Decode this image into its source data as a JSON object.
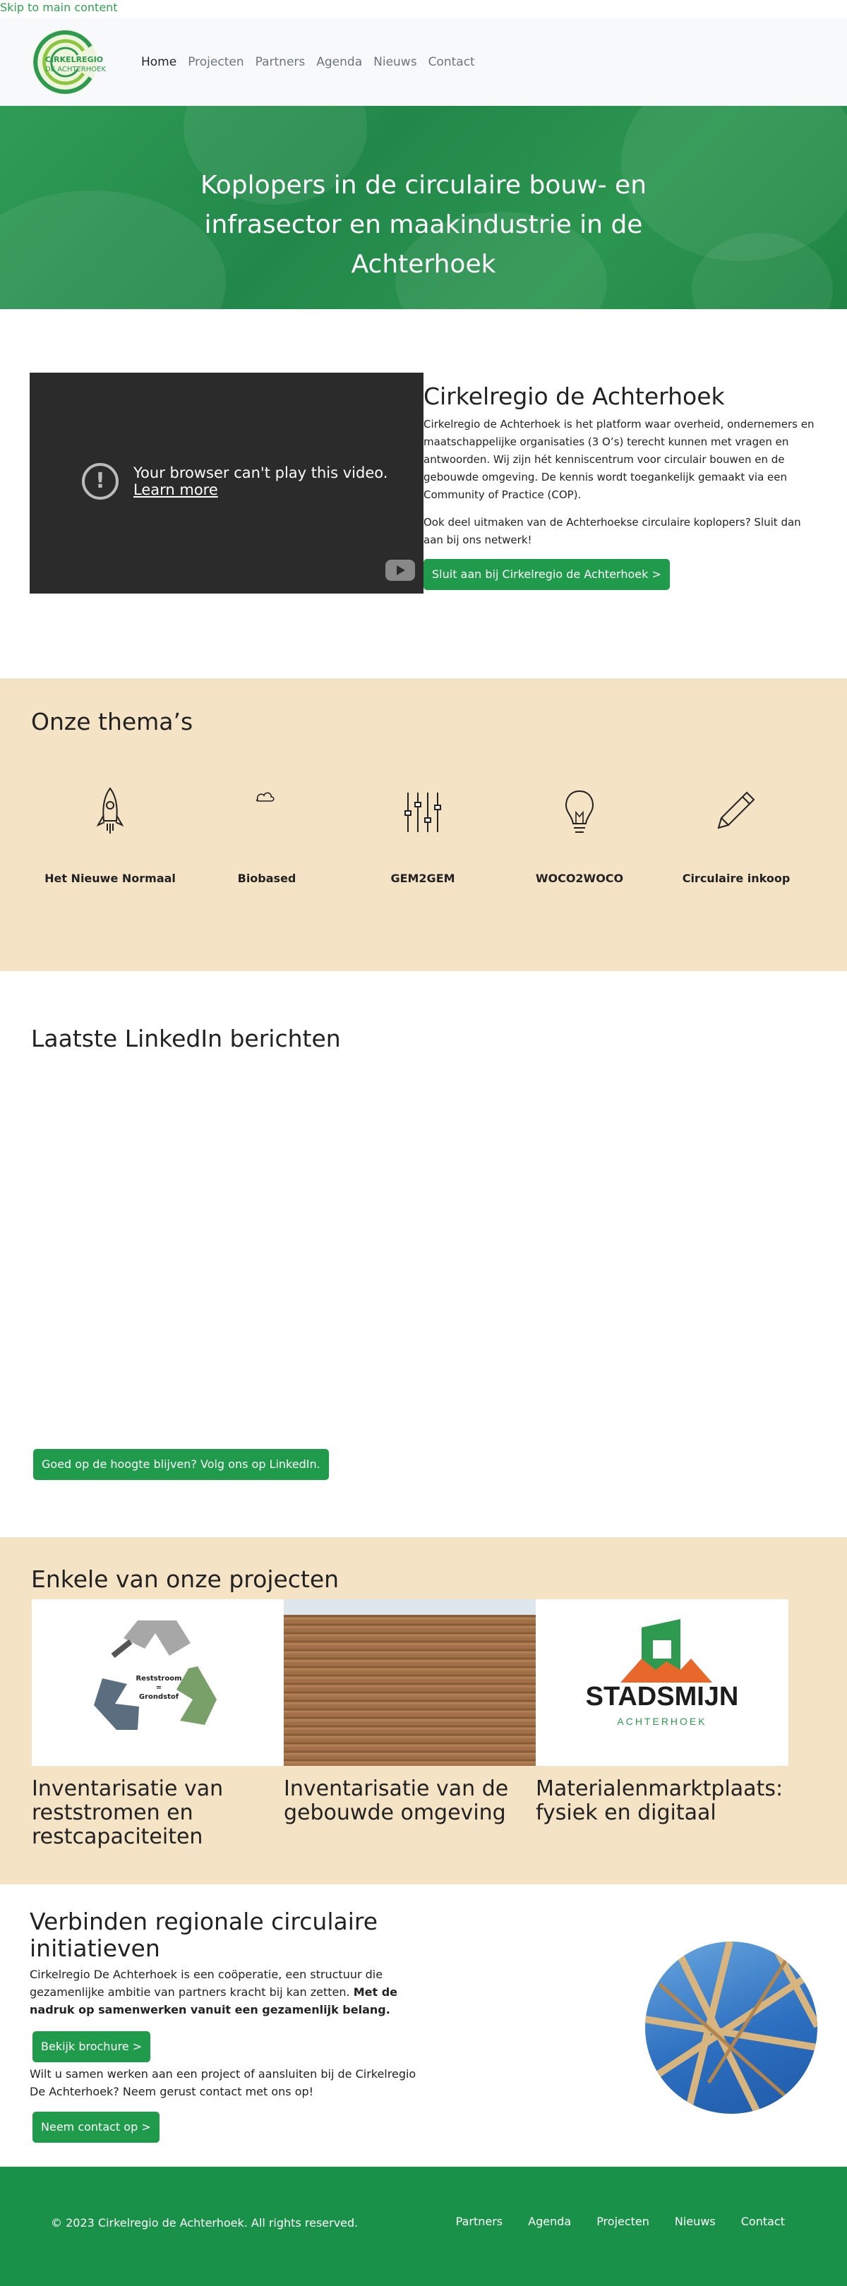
{
  "skip_link": "Skip to main content",
  "colors": {
    "brand_green": "#1f9b4b",
    "beige": "#f5e3c6",
    "footer_green": "#1a9148"
  },
  "logo": {
    "line1": "CIRKELREGIO",
    "line2": "DE ACHTERHOEK"
  },
  "nav": {
    "items": [
      {
        "label": "Home"
      },
      {
        "label": "Projecten"
      },
      {
        "label": "Partners"
      },
      {
        "label": "Agenda"
      },
      {
        "label": "Nieuws"
      },
      {
        "label": "Contact"
      }
    ]
  },
  "hero": {
    "title": "Koplopers in de circulaire bouw- en infrasector en maakindustrie in de Achterhoek"
  },
  "video": {
    "message": "Your browser can't play this video.",
    "learn_more": "Learn more",
    "warn_icon": "!"
  },
  "intro": {
    "title": "Cirkelregio de Achterhoek",
    "p1": "Cirkelregio de Achterhoek is het platform waar overheid, ondernemers en maatschappelijke organisaties (3 O’s) terecht kunnen met vragen en antwoorden. Wij zijn hét kenniscentrum voor circulair bouwen en de gebouwde omgeving. De kennis wordt toegankelijk gemaakt via een Community of Practice (COP).",
    "p2": "Ook deel uitmaken van de Achterhoekse circulaire koplopers? Sluit dan aan bij ons netwerk!",
    "button": "Sluit aan bij Cirkelregio de Achterhoek >"
  },
  "themes": {
    "title": "Onze thema’s",
    "items": [
      {
        "label": "Het Nieuwe Normaal",
        "icon": "rocket-icon"
      },
      {
        "label": "Biobased",
        "icon": "cloud-icon"
      },
      {
        "label": "GEM2GEM",
        "icon": "sliders-icon"
      },
      {
        "label": "WOCO2WOCO",
        "icon": "lightbulb-icon"
      },
      {
        "label": "Circulaire inkoop",
        "icon": "pencil-icon"
      }
    ]
  },
  "linkedin": {
    "title": "Laatste LinkedIn berichten",
    "button": "Goed op de hoogte blijven? Volg ons op LinkedIn."
  },
  "projects": {
    "title": "Enkele van onze projecten",
    "items": [
      {
        "title": "Inventarisatie van reststromen en restcapaciteiten",
        "img_line1": "Reststroom",
        "img_line2": "=",
        "img_line3": "Grondstof"
      },
      {
        "title": "Inventarisatie van de gebouwde omgeving"
      },
      {
        "title": "Materialenmarktplaats: fysiek en digitaal",
        "img_line1": "STADSMIJN",
        "img_line2": "ACHTERHOEK"
      }
    ]
  },
  "connect": {
    "title": "Verbinden regionale circulaire initiatieven",
    "p1_regular": "Cirkelregio De Achterhoek is een coöperatie, een structuur die gezamenlijke ambitie van partners kracht bij kan zetten.",
    "p1_bold": "Met de nadruk op samenwerken vanuit een gezamenlijk belang.",
    "button1": "Bekijk brochure >",
    "p2": "Wilt u samen werken aan een project of aansluiten bij de Cirkelregio De Achterhoek? Neem gerust contact met ons op!",
    "button2": "Neem contact op >"
  },
  "footer": {
    "copyright": "© 2023 Cirkelregio de Achterhoek. All rights reserved.",
    "links": [
      {
        "label": "Partners"
      },
      {
        "label": "Agenda"
      },
      {
        "label": "Projecten"
      },
      {
        "label": "Nieuws"
      },
      {
        "label": "Contact"
      }
    ]
  }
}
